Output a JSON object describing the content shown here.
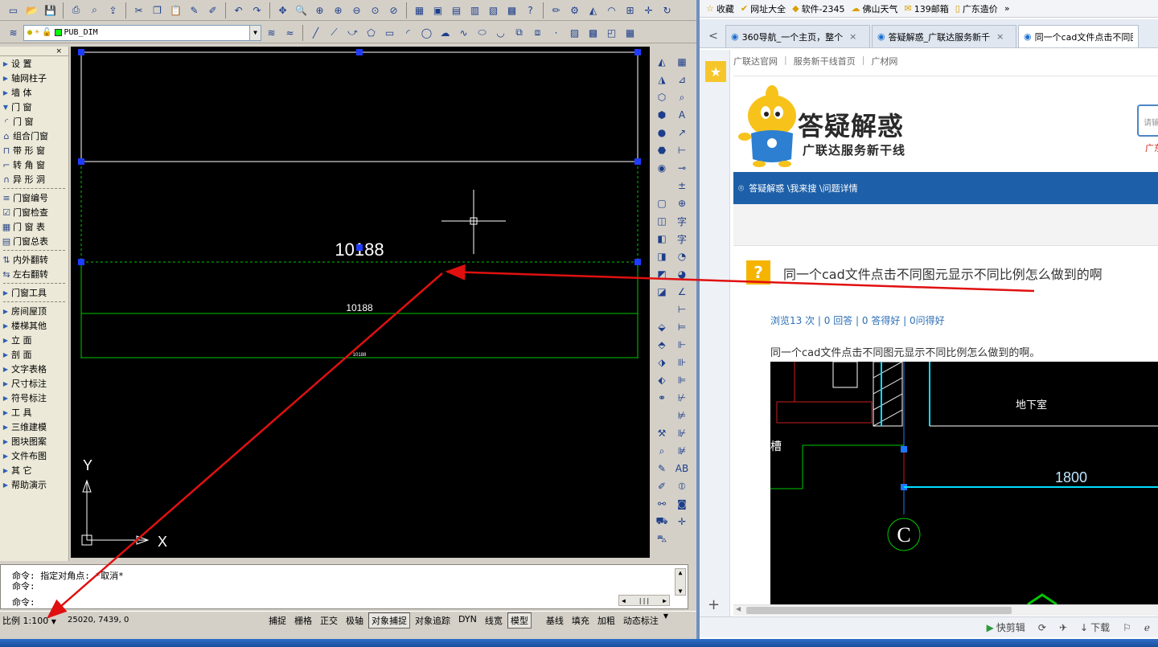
{
  "cad": {
    "layer": {
      "name": "PUB_DIM",
      "color": "#00ff00"
    },
    "palette": {
      "close": "×",
      "items": [
        {
          "label": "设 置",
          "type": "group"
        },
        {
          "label": "轴网柱子",
          "type": "group"
        },
        {
          "label": "墙 体",
          "type": "group"
        },
        {
          "label": "门 窗",
          "type": "open"
        },
        {
          "label": "门 窗",
          "type": "sub",
          "icon": "door-icon"
        },
        {
          "label": "组合门窗",
          "type": "sub",
          "icon": "combo-window-icon"
        },
        {
          "label": "带 形 窗",
          "type": "sub",
          "icon": "strip-window-icon"
        },
        {
          "label": "转 角 窗",
          "type": "sub",
          "icon": "corner-window-icon"
        },
        {
          "label": "异 形 洞",
          "type": "sub",
          "icon": "arch-opening-icon"
        },
        {
          "label": "门窗编号",
          "type": "sub",
          "icon": "window-number-icon"
        },
        {
          "label": "门窗检查",
          "type": "sub",
          "icon": "window-check-icon"
        },
        {
          "label": "门 窗 表",
          "type": "sub",
          "icon": "window-table-icon"
        },
        {
          "label": "门窗总表",
          "type": "sub",
          "icon": "window-summary-icon"
        },
        {
          "label": "内外翻转",
          "type": "sub",
          "icon": "flip-inout-icon"
        },
        {
          "label": "左右翻转",
          "type": "sub",
          "icon": "flip-lr-icon"
        },
        {
          "label": "门窗工具",
          "type": "group"
        },
        {
          "label": "房间屋顶",
          "type": "group"
        },
        {
          "label": "楼梯其他",
          "type": "group"
        },
        {
          "label": "立 面",
          "type": "group"
        },
        {
          "label": "剖 面",
          "type": "group"
        },
        {
          "label": "文字表格",
          "type": "group"
        },
        {
          "label": "尺寸标注",
          "type": "group"
        },
        {
          "label": "符号标注",
          "type": "group"
        },
        {
          "label": "工 具",
          "type": "group"
        },
        {
          "label": "三维建模",
          "type": "group"
        },
        {
          "label": "图块图案",
          "type": "group"
        },
        {
          "label": "文件布图",
          "type": "group"
        },
        {
          "label": "其 它",
          "type": "group"
        },
        {
          "label": "帮助演示",
          "type": "group"
        }
      ]
    },
    "drawing": {
      "dim_large": "10188",
      "dim_medium": "10188",
      "dim_small": "10188",
      "axis_x": "X",
      "axis_y": "Y"
    },
    "command": {
      "line1": "命令: 指定对角点: *取消*",
      "line2": "命令:",
      "line3": "命令:"
    },
    "status": {
      "scale": "比例 1:100",
      "coords": "25020, 7439, 0",
      "buttons": [
        {
          "label": "捕捉",
          "on": false
        },
        {
          "label": "栅格",
          "on": false
        },
        {
          "label": "正交",
          "on": false
        },
        {
          "label": "极轴",
          "on": false
        },
        {
          "label": "对象捕捉",
          "on": true
        },
        {
          "label": "对象追踪",
          "on": false
        },
        {
          "label": "DYN",
          "on": false
        },
        {
          "label": "线宽",
          "on": false
        },
        {
          "label": "模型",
          "on": true
        },
        {
          "label": "基线",
          "on": false
        },
        {
          "label": "填充",
          "on": false
        },
        {
          "label": "加粗",
          "on": false
        },
        {
          "label": "动态标注",
          "on": false
        }
      ]
    }
  },
  "browser": {
    "favbar": [
      {
        "label": "收藏",
        "icon": "star-icon"
      },
      {
        "label": "网址大全",
        "icon": "hao-icon"
      },
      {
        "label": "软件-2345",
        "icon": "software-icon"
      },
      {
        "label": "佛山天气",
        "icon": "weather-icon"
      },
      {
        "label": "139邮箱",
        "icon": "mail-icon"
      },
      {
        "label": "广东造价",
        "icon": "page-icon"
      }
    ],
    "tabs": [
      {
        "label": "360导航_一个主页，整个",
        "active": false
      },
      {
        "label": "答疑解惑_广联达服务新千",
        "active": false
      },
      {
        "label": "同一个cad文件点击不同图",
        "active": true
      }
    ],
    "page": {
      "toplinks": [
        "广联达官网",
        "服务新干线首页",
        "广材网"
      ],
      "brand_title": "答疑解惑",
      "brand_sub": "广联达服务新干线",
      "search_placeholder": "请输",
      "red_text": "广东",
      "breadcrumb": "答疑解惑 \\我来搜 \\问题详情",
      "question_title": "同一个cad文件点击不同图元显示不同比例怎么做到的啊",
      "stats": "浏览13 次 | 0 回答 | 0 答得好 | 0问得好",
      "body": "同一个cad文件点击不同图元显示不同比例怎么做到的啊。",
      "img_label_basement": "地下室",
      "img_label_dim": "1800",
      "img_label_axis": "C",
      "img_label_side": "槽"
    },
    "bottom": [
      {
        "label": "快剪辑",
        "icon": "clip-icon"
      },
      {
        "label": "",
        "icon": "refresh-icon"
      },
      {
        "label": "",
        "icon": "pin-icon"
      },
      {
        "label": "下载",
        "icon": "download-icon"
      },
      {
        "label": "",
        "icon": "flag-icon"
      },
      {
        "label": "",
        "icon": "ie-icon"
      }
    ]
  },
  "colors": {
    "cad_bg": "#000000",
    "dim_green": "#00c800",
    "grip_blue": "#1e3cff",
    "arrow_red": "#e01010",
    "browser_blue": "#1d5fa8"
  }
}
